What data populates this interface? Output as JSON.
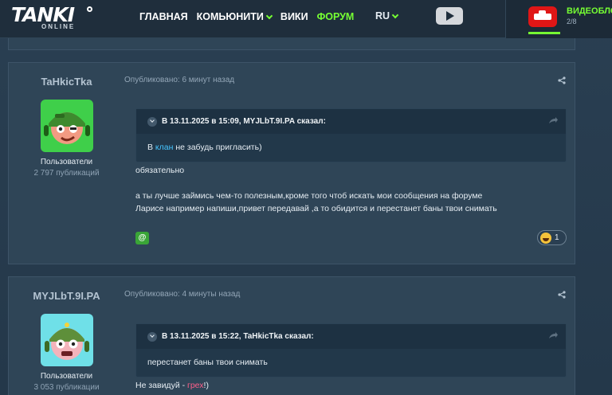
{
  "header": {
    "logo_main": "TANKI",
    "logo_sub": "ONLINE",
    "nav": [
      {
        "label": "ГЛАВНАЯ"
      },
      {
        "label": "КОМЬЮНИТИ"
      },
      {
        "label": "ВИКИ"
      },
      {
        "label": "ФОРУМ"
      }
    ],
    "language": "RU",
    "video_title": "ВИДЕОБЛО",
    "video_count": "2/8"
  },
  "posts": [
    {
      "author": "TaHkicTka",
      "group": "Пользователи",
      "count": "2 797 публикаций",
      "published": "Опубликовано: 6 минут назад",
      "quote_header": "В 13.11.2025 в 15:09, MYJLbT.9I.PA сказал:",
      "quote_before": "В ",
      "quote_link": "клан",
      "quote_after": " не забудь пригласить)",
      "lines": [
        "обязательно",
        "а ты лучше займись чем-то полезным,кроме того чтоб искать мои сообщения на форуме",
        "Ларисе например напиши,привет передавай ,а то обидится и перестанет баны твои снимать"
      ],
      "mention": "@",
      "reaction_count": "1",
      "colors": {
        "avatar_bg": "#3fcf4a",
        "helmet": "#3e8a2e",
        "face": "#f29a82"
      }
    },
    {
      "author": "MYJLbT.9I.PA",
      "group": "Пользователи",
      "count": "3 053 публикации",
      "published": "Опубликовано: 4 минуты назад",
      "quote_header": "В 13.11.2025 в 15:22, TaHkicTka сказал:",
      "quote_text": "перестанет баны твои снимать",
      "line_before": "Не завидуй - ",
      "line_link": "грех",
      "line_after": "!)",
      "colors": {
        "avatar_bg": "#6fe0e8",
        "helmet": "#5e8f3a",
        "face": "#f3b3bb"
      }
    }
  ],
  "colors": {
    "accent": "#76ff33",
    "link": "#46c5ff",
    "link_pink": "#ff5f8a",
    "card": "#2f4557"
  }
}
